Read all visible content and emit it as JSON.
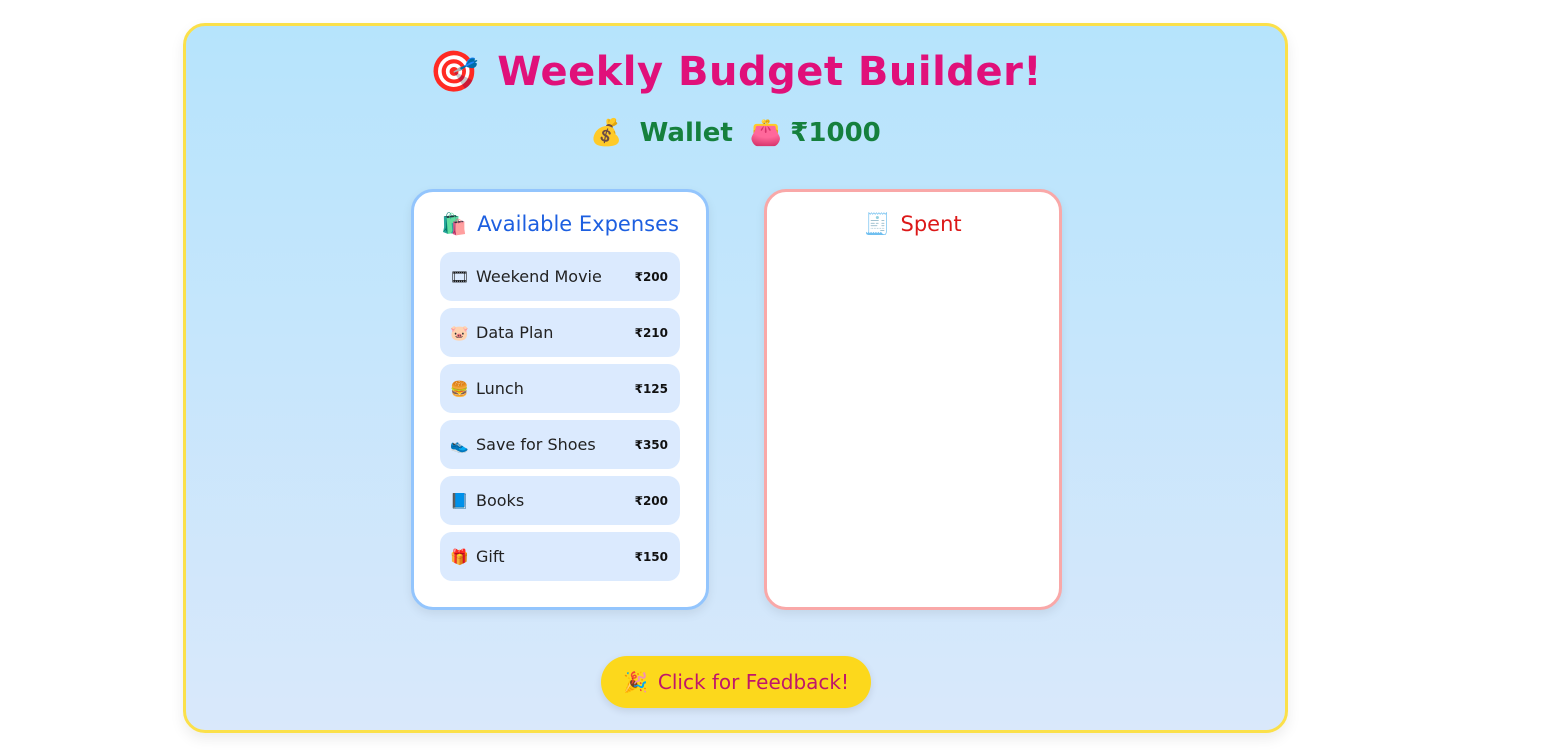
{
  "header": {
    "title_icon": "🎯",
    "title": "Weekly Budget Builder!",
    "wallet_icon": "💰",
    "wallet_label": "Wallet",
    "wallet_card_icon": "👛",
    "wallet_amount": "₹1000"
  },
  "available": {
    "icon": "🛍️",
    "title": "Available Expenses",
    "items": [
      {
        "icon": "🎞",
        "label": "Weekend Movie",
        "price": "₹200"
      },
      {
        "icon": "🐷",
        "label": "Data Plan",
        "price": "₹210"
      },
      {
        "icon": "🍔",
        "label": "Lunch",
        "price": "₹125"
      },
      {
        "icon": "👟",
        "label": "Save for Shoes",
        "price": "₹350"
      },
      {
        "icon": "📘",
        "label": "Books",
        "price": "₹200"
      },
      {
        "icon": "🎁",
        "label": "Gift",
        "price": "₹150"
      }
    ]
  },
  "spent": {
    "icon": "🧾",
    "title": "Spent"
  },
  "feedback": {
    "icon": "🎉",
    "label": "Click for Feedback!"
  },
  "colors": {
    "accent_title": "#e0107a",
    "wallet": "#15803d",
    "available_border": "#93c5fd",
    "spent_border": "#f9a8a8",
    "button": "#fcd81c"
  }
}
